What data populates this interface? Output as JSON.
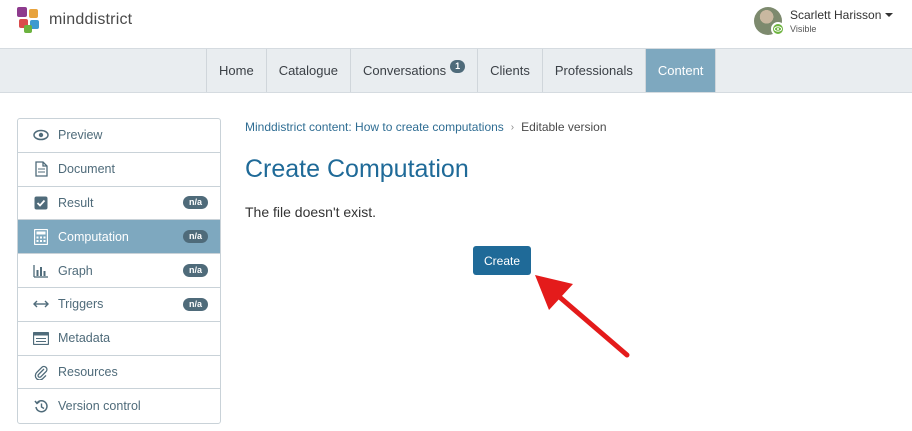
{
  "brand": {
    "name": "minddistrict",
    "colors": {
      "accent": "#1f6a98",
      "nav_active": "#7ea8bf",
      "badge": "#4f6b7a"
    }
  },
  "user": {
    "name": "Scarlett Harisson",
    "status": "Visible",
    "status_icon": "eye-icon"
  },
  "nav": {
    "tabs": [
      {
        "label": "Home"
      },
      {
        "label": "Catalogue"
      },
      {
        "label": "Conversations",
        "badge": "1"
      },
      {
        "label": "Clients"
      },
      {
        "label": "Professionals"
      },
      {
        "label": "Content",
        "active": true
      }
    ]
  },
  "sidebar": {
    "items": [
      {
        "label": "Preview",
        "icon": "eye-icon"
      },
      {
        "label": "Document",
        "icon": "document-icon"
      },
      {
        "label": "Result",
        "icon": "checkbox-icon",
        "badge": "n/a"
      },
      {
        "label": "Computation",
        "icon": "calculator-icon",
        "badge": "n/a",
        "active": true
      },
      {
        "label": "Graph",
        "icon": "bar-chart-icon",
        "badge": "n/a"
      },
      {
        "label": "Triggers",
        "icon": "arrows-horizontal-icon",
        "badge": "n/a"
      },
      {
        "label": "Metadata",
        "icon": "list-icon"
      },
      {
        "label": "Resources",
        "icon": "paperclip-icon"
      },
      {
        "label": "Version control",
        "icon": "history-icon"
      }
    ]
  },
  "breadcrumb": {
    "link": "Minddistrict content: How to create computations",
    "current": "Editable version"
  },
  "main": {
    "title": "Create Computation",
    "message": "The file doesn't exist.",
    "create_label": "Create"
  }
}
